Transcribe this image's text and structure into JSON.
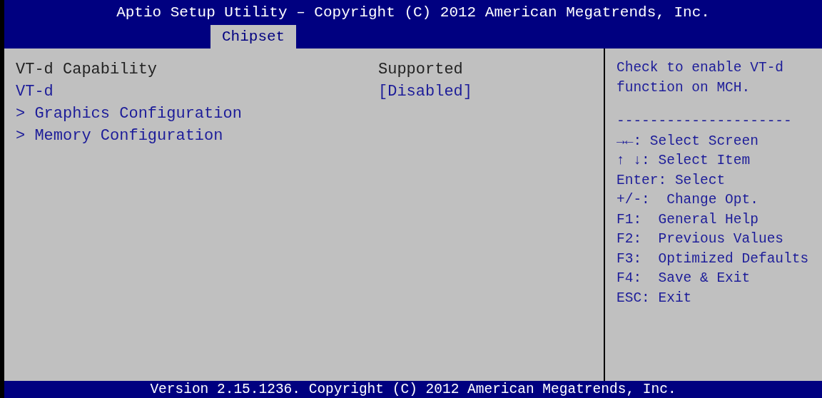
{
  "title": "Aptio Setup Utility – Copyright (C) 2012 American Megatrends, Inc.",
  "tabs": [
    {
      "label": "Chipset",
      "selected": true
    }
  ],
  "items": [
    {
      "kind": "info",
      "label": "VT-d Capability",
      "value": "Supported"
    },
    {
      "kind": "option",
      "label": "VT-d",
      "value": "[Disabled]"
    },
    {
      "kind": "submenu",
      "label": "> Graphics Configuration"
    },
    {
      "kind": "submenu",
      "label": "> Memory Configuration"
    }
  ],
  "help_text": "Check to enable VT-d function on MCH.",
  "separator": "---------------------",
  "help_keys": [
    "→←: Select Screen",
    "↑ ↓: Select Item",
    "Enter: Select",
    "+/-:  Change Opt.",
    "F1:  General Help",
    "F2:  Previous Values",
    "F3:  Optimized Defaults",
    "F4:  Save & Exit",
    "ESC: Exit"
  ],
  "footer": "Version 2.15.1236. Copyright (C) 2012 American Megatrends, Inc."
}
